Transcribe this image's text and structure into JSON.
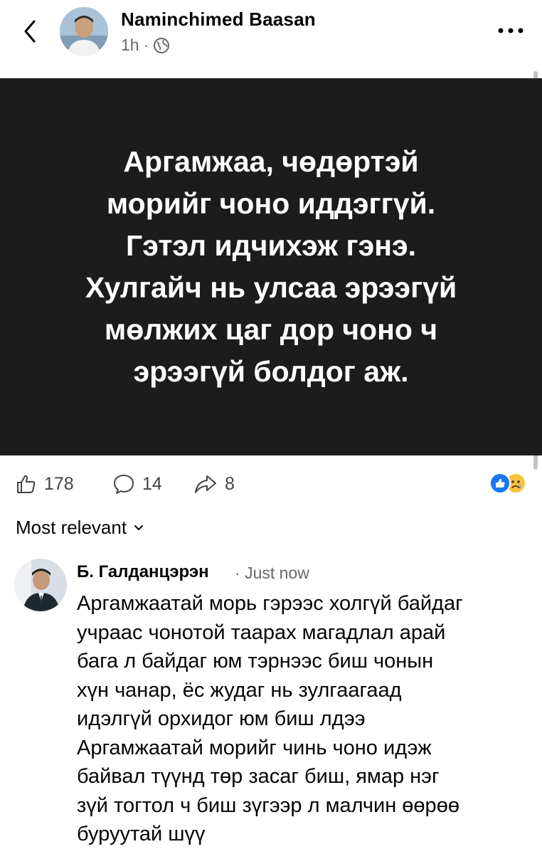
{
  "header": {
    "author_name": "Naminchimed Baasan",
    "time": "1h",
    "separator": "·",
    "privacy_icon": "globe-icon",
    "back_icon": "chevron-left-icon",
    "more_icon": "more-horizontal-icon"
  },
  "post": {
    "background": "#1c1c1c",
    "text": "Аргамжаа, чөдөртэй\nморийг чоно иддэггүй.\nГэтэл идчихэж гэнэ.\nХулгайч нь улсаа эрээгүй\nмөлжих цаг дор чоно ч\nэрээгүй болдог аж."
  },
  "actions": {
    "like_count": "178",
    "comment_count": "14",
    "share_count": "8",
    "like_icon": "thumbs-up-icon",
    "comment_icon": "comment-icon",
    "share_icon": "share-icon",
    "reactions": [
      "like-reaction-icon",
      "sad-reaction-icon"
    ]
  },
  "comments_section": {
    "sort_label": "Most relevant",
    "sort_icon": "chevron-down-icon"
  },
  "comment": {
    "author": "Б. Галданцэрэн",
    "separator": "·",
    "time": "Just now",
    "text": "Аргамжаатай морь гэрээс холгүй байдаг\nучраас чонотой таарах магадлал арай\nбага л байдаг юм тэрнээс биш чонын\nхүн чанар, ёс жудаг нь зулгаагаад\nидэлгүй орхидог юм биш лдээ\nАргамжаатай морийг чинь чоно идэж\nбайвал түүнд төр засаг биш, ямар нэг\nзүй тогтол ч биш зүгээр л малчин өөрөө\nбуруутай шүү"
  }
}
